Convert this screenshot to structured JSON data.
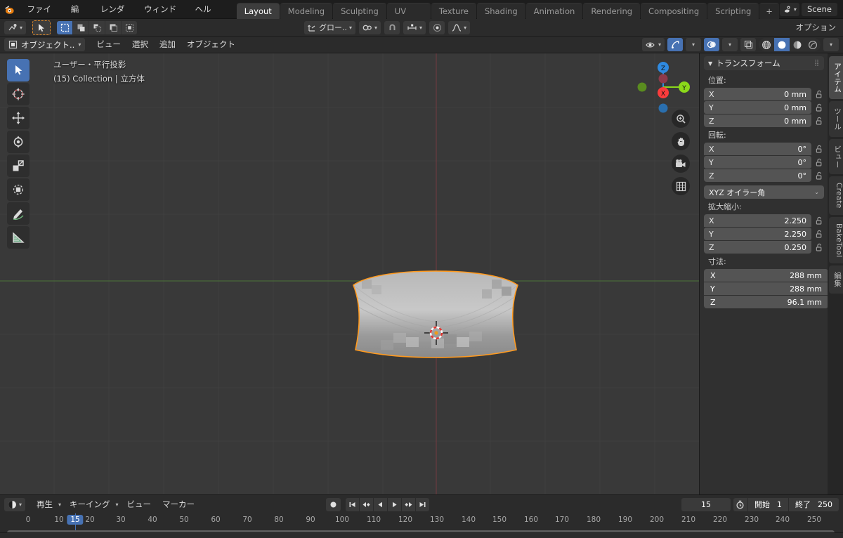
{
  "topbar": {
    "logo_icon": "blender-logo-icon",
    "menus": [
      "ファイル",
      "編集",
      "レンダー",
      "ウィンドウ",
      "ヘルプ"
    ],
    "tabs": [
      {
        "label": "Layout",
        "active": true
      },
      {
        "label": "Modeling",
        "active": false
      },
      {
        "label": "Sculpting",
        "active": false
      },
      {
        "label": "UV Editing",
        "active": false
      },
      {
        "label": "Texture Paint",
        "active": false
      },
      {
        "label": "Shading",
        "active": false
      },
      {
        "label": "Animation",
        "active": false
      },
      {
        "label": "Rendering",
        "active": false
      },
      {
        "label": "Compositing",
        "active": false
      },
      {
        "label": "Scripting",
        "active": false
      }
    ],
    "add_tab_label": "+",
    "scene_icon": "scene-data-icon",
    "scene_name": "Scene"
  },
  "toolsettings": {
    "editor_type_icon": "editor-type-icon",
    "active_tool_icon": "cursor-select-icon",
    "select_modes": [
      "select-box-icon",
      "select-extend-icon",
      "select-subtract-icon",
      "select-invert-icon",
      "select-intersect-icon"
    ],
    "transform_orientation_icon": "orientation-icon",
    "transform_orientation_label": "グロー..",
    "pivot_icon": "pivot-point-icon",
    "snap_magnet_icon": "snap-magnet-icon",
    "snap_target_icon": "snap-increment-icon",
    "proportional_icon": "proportional-edit-icon",
    "proportional_falloff_icon": "falloff-curve-icon"
  },
  "viewport_header": {
    "mode_icon": "object-mode-icon",
    "mode_label": "オブジェクト..",
    "menus": [
      "ビュー",
      "選択",
      "追加",
      "オブジェクト"
    ],
    "visibility_icon": "visibility-icon",
    "gizmo_icon": "gizmo-icon",
    "overlays_icon": "overlays-icon",
    "xray_icon": "xray-toggle-icon",
    "shading_modes": [
      {
        "icon": "shading-wireframe-icon",
        "active": false
      },
      {
        "icon": "shading-solid-icon",
        "active": true
      },
      {
        "icon": "shading-material-icon",
        "active": false
      },
      {
        "icon": "shading-rendered-icon",
        "active": false
      }
    ]
  },
  "viewport": {
    "overlay_line1": "ユーザー・平行投影",
    "overlay_line2": "(15) Collection | 立方体",
    "tools": [
      {
        "icon": "tweak-select-icon",
        "active": true
      },
      {
        "icon": "cursor-3d-icon",
        "active": false
      },
      {
        "icon": "move-icon",
        "active": false
      },
      {
        "icon": "rotate-icon",
        "active": false
      },
      {
        "icon": "scale-icon",
        "active": false
      },
      {
        "icon": "transform-icon",
        "active": false
      },
      {
        "icon": "annotate-icon",
        "active": false
      },
      {
        "icon": "measure-icon",
        "active": false
      }
    ],
    "nav_buttons": [
      {
        "icon": "zoom-icon"
      },
      {
        "icon": "hand-pan-icon"
      },
      {
        "icon": "camera-view-icon"
      },
      {
        "icon": "toggle-ortho-grid-icon"
      }
    ],
    "axis_gizmo": {
      "x_label": "X",
      "y_label": "Y",
      "z_label": "Z",
      "x_color": "#fa3c3c",
      "y_color": "#8bd91a",
      "z_color": "#2f8ae0"
    },
    "object": {
      "name": "立方体",
      "selected": true,
      "outline_color": "#ff9a1f"
    }
  },
  "sidebar": {
    "panel_title": "トランスフォーム",
    "collapse_icon": "triangle-down-icon",
    "grip_icon": "drag-grip-icon",
    "location": {
      "label": "位置:",
      "rows": [
        {
          "axis": "X",
          "value": "0 mm"
        },
        {
          "axis": "Y",
          "value": "0 mm"
        },
        {
          "axis": "Z",
          "value": "0 mm"
        }
      ]
    },
    "rotation": {
      "label": "回転:",
      "rows": [
        {
          "axis": "X",
          "value": "0°"
        },
        {
          "axis": "Y",
          "value": "0°"
        },
        {
          "axis": "Z",
          "value": "0°"
        }
      ],
      "mode_label": "XYZ オイラー角"
    },
    "scale": {
      "label": "拡大縮小:",
      "rows": [
        {
          "axis": "X",
          "value": "2.250"
        },
        {
          "axis": "Y",
          "value": "2.250"
        },
        {
          "axis": "Z",
          "value": "0.250"
        }
      ]
    },
    "dimensions": {
      "label": "寸法:",
      "rows": [
        {
          "axis": "X",
          "value": "288 mm"
        },
        {
          "axis": "Y",
          "value": "288 mm"
        },
        {
          "axis": "Z",
          "value": "96.1 mm"
        }
      ]
    },
    "lock_icon": "unlocked-icon",
    "vertical_tabs": [
      {
        "label": "アイテム",
        "active": true,
        "lat": false
      },
      {
        "label": "ツール",
        "active": false,
        "lat": false
      },
      {
        "label": "ビュー",
        "active": false,
        "lat": false
      },
      {
        "label": "Create",
        "active": false,
        "lat": true
      },
      {
        "label": "BakeTool",
        "active": false,
        "lat": true
      },
      {
        "label": "編集",
        "active": false,
        "lat": false
      }
    ]
  },
  "timeline": {
    "editor_icon": "timeline-editor-icon",
    "menus": [
      "再生",
      "キーイング",
      "ビュー",
      "マーカー"
    ],
    "record_icon": "record-keyframe-icon",
    "transport": [
      {
        "icon": "jump-start-icon"
      },
      {
        "icon": "prev-keyframe-icon"
      },
      {
        "icon": "play-reverse-icon"
      },
      {
        "icon": "play-icon"
      },
      {
        "icon": "next-keyframe-icon"
      },
      {
        "icon": "jump-end-icon"
      }
    ],
    "current_frame": "15",
    "timer_icon": "timer-icon",
    "start_label": "開始",
    "start_value": "1",
    "end_label": "終了",
    "end_value": "250",
    "ruler_ticks": [
      "0",
      "10",
      "20",
      "30",
      "40",
      "50",
      "60",
      "70",
      "80",
      "90",
      "100",
      "110",
      "120",
      "130",
      "140",
      "150",
      "160",
      "170",
      "180",
      "190",
      "200",
      "210",
      "220",
      "230",
      "240",
      "250"
    ],
    "playhead_frame": "15"
  }
}
